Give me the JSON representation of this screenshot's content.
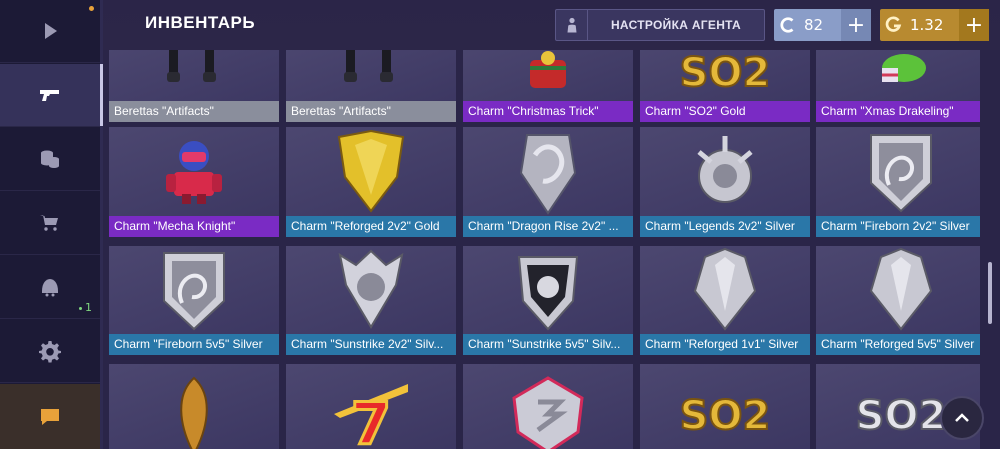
{
  "header": {
    "title": "ИНВЕНТАРЬ",
    "agent_button_label": "НАСТРОЙКА АГЕНТА",
    "silver": {
      "icon": "silver-coin-icon",
      "value": "82"
    },
    "gold": {
      "icon": "gold-coin-icon",
      "value": "1.32"
    }
  },
  "sidebar": {
    "items": [
      {
        "name": "play",
        "icon": "play-icon"
      },
      {
        "name": "inventory",
        "icon": "pistol-icon",
        "active": true
      },
      {
        "name": "coins",
        "icon": "coins-icon"
      },
      {
        "name": "shop",
        "icon": "cart-icon"
      },
      {
        "name": "clan",
        "icon": "helmet-icon",
        "count": "1"
      },
      {
        "name": "settings",
        "icon": "gear-icon"
      },
      {
        "name": "chat",
        "icon": "chat-icon"
      }
    ]
  },
  "colors": {
    "gray": "#8a8e9c",
    "purple": "#7a2bc4",
    "blue": "#2a77a8"
  },
  "items": [
    {
      "label": "Berettas \"Artifacts\"",
      "rarity": "gray",
      "icon": "berettas-art"
    },
    {
      "label": "Berettas \"Artifacts\"",
      "rarity": "gray",
      "icon": "berettas-art"
    },
    {
      "label": "Charm \"Christmas Trick\"",
      "rarity": "purple",
      "icon": "gift-basket-art"
    },
    {
      "label": "Charm \"SO2\" Gold",
      "rarity": "purple",
      "icon": "so2-gold-art"
    },
    {
      "label": "Charm \"Xmas Drakeling\"",
      "rarity": "purple",
      "icon": "drakeling-art"
    },
    {
      "label": "Charm \"Mecha Knight\"",
      "rarity": "purple",
      "icon": "mecha-knight-art"
    },
    {
      "label": "Charm \"Reforged 2v2\" Gold",
      "rarity": "blue",
      "icon": "reforged-gold-art"
    },
    {
      "label": "Charm \"Dragon Rise 2v2\" ...",
      "rarity": "blue",
      "icon": "dragon-rise-art"
    },
    {
      "label": "Charm \"Legends 2v2\" Silver",
      "rarity": "blue",
      "icon": "legends-art"
    },
    {
      "label": "Charm \"Fireborn 2v2\" Silver",
      "rarity": "blue",
      "icon": "fireborn-art"
    },
    {
      "label": "Charm \"Fireborn 5v5\" Silver",
      "rarity": "blue",
      "icon": "fireborn-art"
    },
    {
      "label": "Charm \"Sunstrike 2v2\" Silv...",
      "rarity": "blue",
      "icon": "sunstrike-art"
    },
    {
      "label": "Charm \"Sunstrike 5v5\" Silv...",
      "rarity": "blue",
      "icon": "sunstrike-dark-art"
    },
    {
      "label": "Charm \"Reforged 1v1\" Silver",
      "rarity": "blue",
      "icon": "reforged-silver-art"
    },
    {
      "label": "Charm \"Reforged 5v5\" Silver",
      "rarity": "blue",
      "icon": "reforged-silver-art"
    },
    {
      "label": "",
      "rarity": "none",
      "icon": "wing-art"
    },
    {
      "label": "",
      "rarity": "none",
      "icon": "seven-art"
    },
    {
      "label": "",
      "rarity": "none",
      "icon": "gem-art"
    },
    {
      "label": "",
      "rarity": "none",
      "icon": "so2-gold-art"
    },
    {
      "label": "",
      "rarity": "none",
      "icon": "so2-silver-art"
    }
  ]
}
